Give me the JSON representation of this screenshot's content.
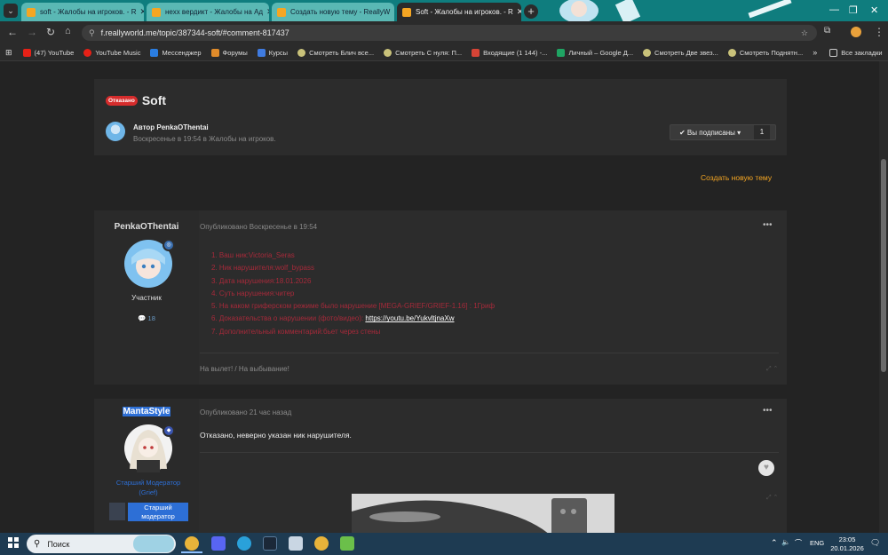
{
  "browser": {
    "tabs": [
      {
        "title": "soft - Жалобы на игроков. - R",
        "active": false
      },
      {
        "title": "нехх вердикт - Жалобы на Ад",
        "active": false
      },
      {
        "title": "Создать новую тему - ReallyW",
        "active": false
      },
      {
        "title": "Soft - Жалобы на игроков. - R",
        "active": true
      }
    ],
    "url": "f.reallyworld.me/topic/387344-soft/#comment-817437",
    "bookmarks": [
      {
        "label": "(47) YouTube",
        "color": "#e62117"
      },
      {
        "label": "YouTube Music",
        "color": "#e62117"
      },
      {
        "label": "Мессенджер",
        "color": "#2a7de1"
      },
      {
        "label": "Форумы",
        "color": "#e08b2a"
      },
      {
        "label": "Курсы",
        "color": "#3f7be0"
      },
      {
        "label": "Смотреть Блич все...",
        "color": "#c9c27a"
      },
      {
        "label": "Смотреть С нуля: П...",
        "color": "#c9c27a"
      },
      {
        "label": "Входящие (1 144) -...",
        "color": "#d64436"
      },
      {
        "label": "Личный – Google Д...",
        "color": "#1fa463"
      },
      {
        "label": "Смотреть Две звез...",
        "color": "#c9c27a"
      },
      {
        "label": "Смотреть Поднятн...",
        "color": "#c9c27a"
      }
    ],
    "all_bookmarks": "Все закладки"
  },
  "topic": {
    "status_badge": "Отказано",
    "title": "Soft",
    "author_line": "Автор PenkaOThentai",
    "meta_line": "Воскресенье в 19:54 в Жалобы на игроков.",
    "follow_button": "✔ Вы подписаны ▾",
    "follow_count": "1",
    "create_topic": "Создать новую тему"
  },
  "post1": {
    "author": "PenkaOThentai",
    "role": "Участник",
    "posts_count": "💬 18",
    "published": "Опубликовано Воскресенье в 19:54",
    "lines": [
      "1. Ваш ник:Victoria_Seras",
      "2. Ник нарушителя:wolf_bypass",
      "3. Дата нарушения:18.01.2026",
      "4. Суть нарушения:читер",
      "5. На каком гриферском режиме было нарушение [MEGA-GRIEF/GRIEF-1.16] : 1Гриф",
      "6. Доказательства о нарушении (фото/видео): "
    ],
    "proof_link": "https://youtu.be/YukvltjnaXw",
    "line7": "7. Дополнительный комментарий:бьет через стены",
    "footer": "На вылет! / На выбывание!"
  },
  "post2": {
    "author": "MantaStyle",
    "role": "Старший Модератор (Grief)",
    "badge": "Старший модератор",
    "published": "Опубликовано 21 час назад",
    "text": "Отказано, неверно указан ник нарушителя."
  },
  "taskbar": {
    "search_placeholder": "Поиск",
    "lang": "ENG",
    "time": "23:05",
    "date": "20.01.2026"
  }
}
